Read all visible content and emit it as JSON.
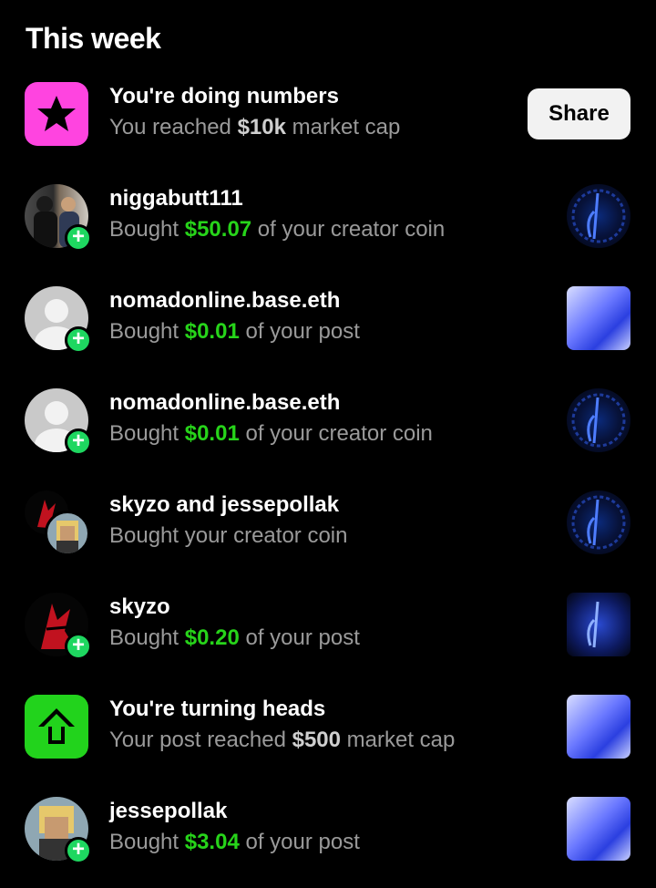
{
  "section": {
    "title": "This week"
  },
  "share_label": "Share",
  "rows": [
    {
      "title": "You're doing numbers",
      "pre": "You reached ",
      "mc": "$10k",
      "post": " market cap",
      "icon": "star-icon",
      "color": "#ff44e0"
    },
    {
      "title": "niggabutt111",
      "pre": "Bought ",
      "amt": "$50.07",
      "post": " of your creator coin"
    },
    {
      "title": "nomadonline.base.eth",
      "pre": "Bought ",
      "amt": "$0.01",
      "post": " of your post"
    },
    {
      "title": "nomadonline.base.eth",
      "pre": "Bought ",
      "amt": "$0.01",
      "post": " of your creator coin"
    },
    {
      "title": "skyzo and jessepollak",
      "pre": "Bought your creator coin",
      "amt": "",
      "post": ""
    },
    {
      "title": "skyzo",
      "pre": "Bought ",
      "amt": "$0.20",
      "post": " of your post"
    },
    {
      "title": "You're turning heads",
      "pre": "Your post reached ",
      "mc": "$500",
      "post": " market cap",
      "icon": "arrow-up-icon",
      "color": "#22d31c"
    },
    {
      "title": "jessepollak",
      "pre": "Bought ",
      "amt": "$3.04",
      "post": " of your post"
    }
  ]
}
